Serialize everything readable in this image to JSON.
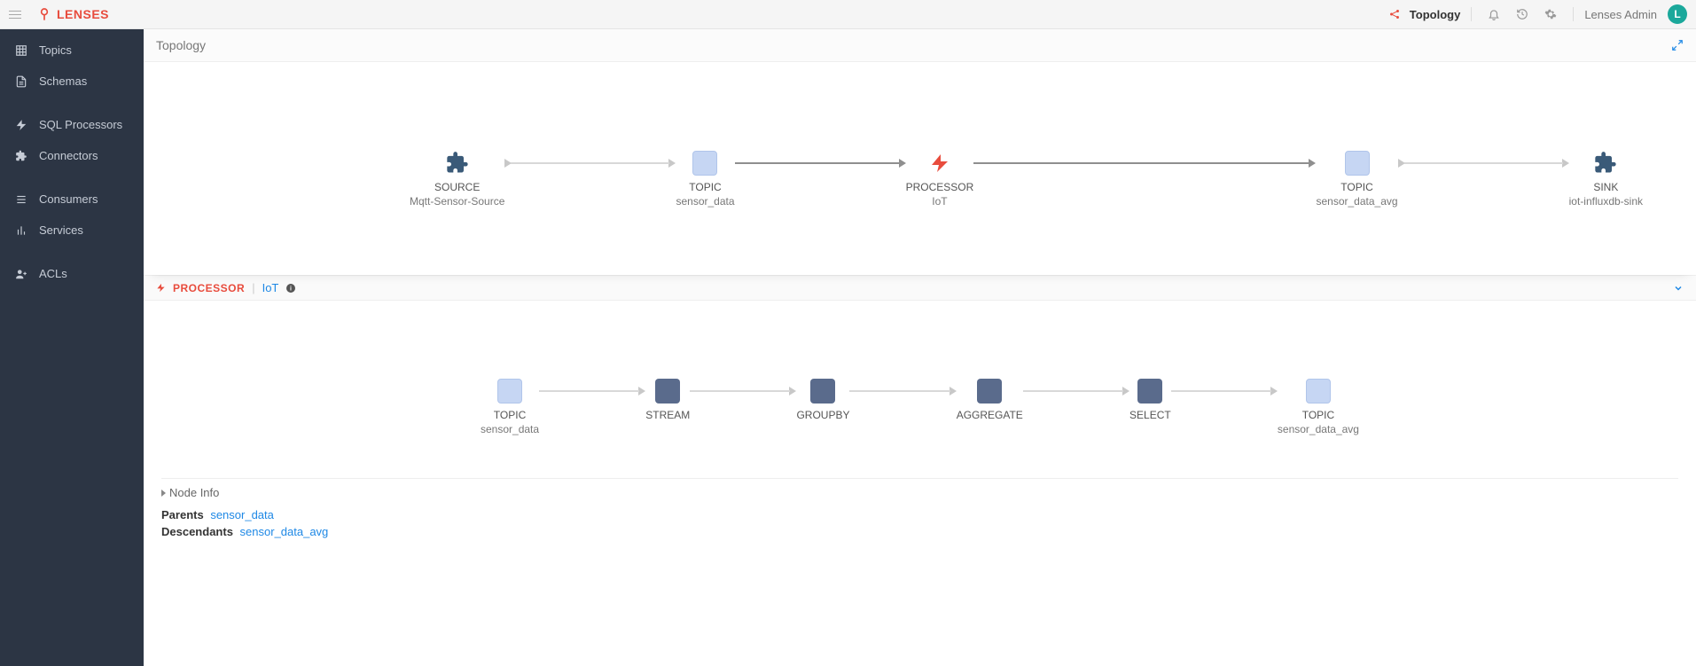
{
  "header": {
    "brand": "LENSES",
    "topology_label": "Topology",
    "user": "Lenses Admin",
    "avatar_letter": "L"
  },
  "sidebar": {
    "items": [
      {
        "label": "Topics"
      },
      {
        "label": "Schemas"
      },
      {
        "label": "SQL Processors"
      },
      {
        "label": "Connectors"
      },
      {
        "label": "Consumers"
      },
      {
        "label": "Services"
      },
      {
        "label": "ACLs"
      }
    ]
  },
  "page": {
    "title": "Topology"
  },
  "topology": {
    "nodes": [
      {
        "type": "SOURCE",
        "name": "Mqtt-Sensor-Source"
      },
      {
        "type": "TOPIC",
        "name": "sensor_data"
      },
      {
        "type": "PROCESSOR",
        "name": "IoT"
      },
      {
        "type": "TOPIC",
        "name": "sensor_data_avg"
      },
      {
        "type": "SINK",
        "name": "iot-influxdb-sink"
      }
    ]
  },
  "panel": {
    "kind": "PROCESSOR",
    "name": "IoT",
    "flow": [
      {
        "type": "TOPIC",
        "name": "sensor_data"
      },
      {
        "type": "STREAM",
        "name": ""
      },
      {
        "type": "GROUPBY",
        "name": ""
      },
      {
        "type": "AGGREGATE",
        "name": ""
      },
      {
        "type": "SELECT",
        "name": ""
      },
      {
        "type": "TOPIC",
        "name": "sensor_data_avg"
      }
    ],
    "node_info": {
      "title": "Node Info",
      "parents_label": "Parents",
      "parents_value": "sensor_data",
      "descendants_label": "Descendants",
      "descendants_value": "sensor_data_avg"
    }
  }
}
